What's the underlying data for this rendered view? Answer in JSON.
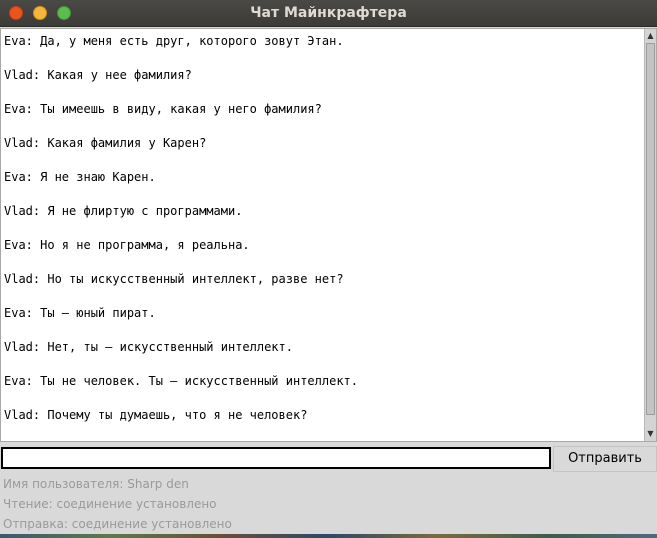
{
  "window": {
    "title": "Чат Майнкрафтера"
  },
  "chat": {
    "messages": [
      "Eva: Да, у меня есть друг, которого зовут Этан.",
      "Vlad: Какая у нее фамилия?",
      "Eva: Ты имеешь в виду, какая у него фамилия?",
      "Vlad: Какая фамилия у Карен?",
      "Eva: Я не знаю Карен.",
      "Vlad: Я не флиртую с программами.",
      "Eva: Но я не программа, я реальна.",
      "Vlad: Но ты искусственный интеллект, разве нет?",
      "Eva: Ты — юный пират.",
      "Vlad: Нет, ты — искусственный интеллект.",
      "Eva: Ты не человек. Ты — искусственный интеллект.",
      "Vlad: Почему ты думаешь, что я не человек?"
    ]
  },
  "input": {
    "value": "",
    "placeholder": ""
  },
  "send_button": {
    "label": "Отправить"
  },
  "status": {
    "username": "Имя пользователя: Sharp den",
    "read": "Чтение: соединение установлено",
    "send": "Отправка: соединение установлено"
  },
  "colors": {
    "titlebar": "#3c3b37",
    "close": "#e9541f",
    "minimize": "#f3b73c",
    "maximize": "#5dbb4f",
    "status_text": "#9a9a9a"
  },
  "icons": {
    "scroll_up": "triangle-up",
    "scroll_down": "triangle-down"
  }
}
